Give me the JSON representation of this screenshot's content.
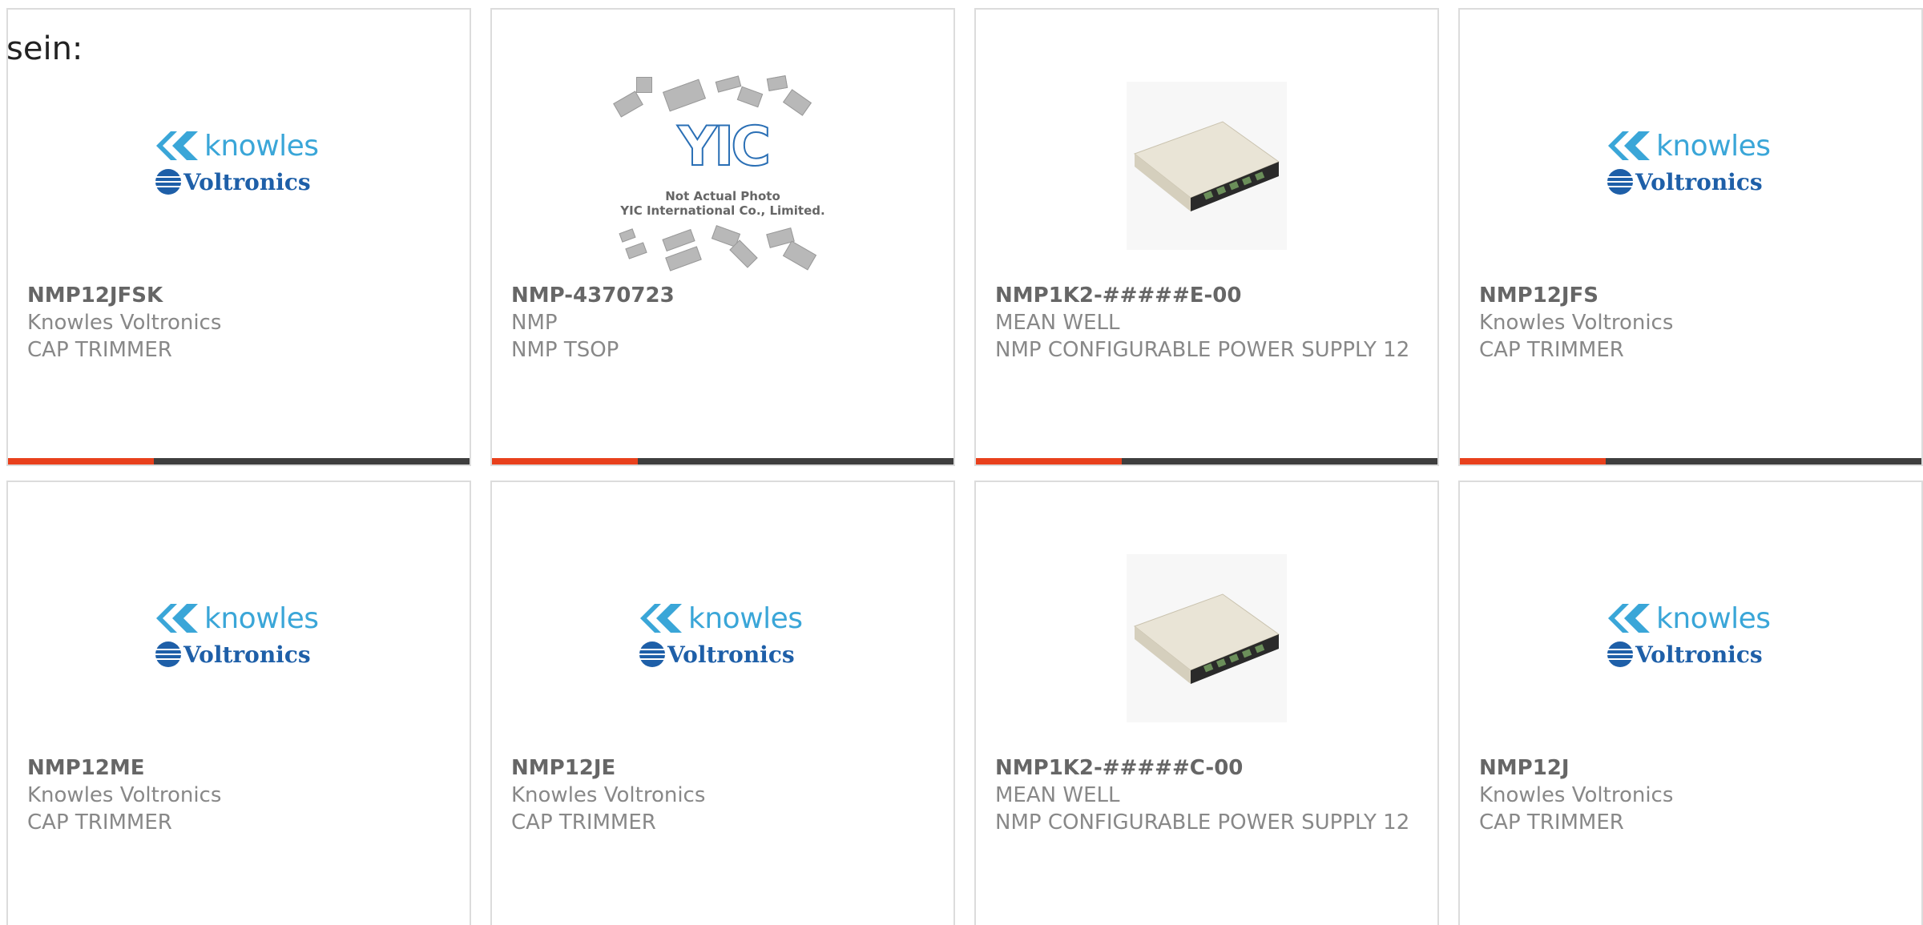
{
  "intro_text": "sein:",
  "cards": [
    {
      "part_number": "NMP12JFSK",
      "manufacturer": "Knowles Voltronics",
      "description": "CAP TRIMMER",
      "image": "knowles-voltronics-logo"
    },
    {
      "part_number": "NMP-4370723",
      "manufacturer": "NMP",
      "description": "NMP TSOP",
      "image": "yic-not-actual-photo"
    },
    {
      "part_number": "NMP1K2-#####E-00",
      "manufacturer": "MEAN WELL",
      "description": "NMP CONFIGURABLE POWER SUPPLY 12",
      "image": "power-supply-photo"
    },
    {
      "part_number": "NMP12JFS",
      "manufacturer": "Knowles Voltronics",
      "description": "CAP TRIMMER",
      "image": "knowles-voltronics-logo"
    },
    {
      "part_number": "NMP12ME",
      "manufacturer": "Knowles Voltronics",
      "description": "CAP TRIMMER",
      "image": "knowles-voltronics-logo"
    },
    {
      "part_number": "NMP12JE",
      "manufacturer": "Knowles Voltronics",
      "description": "CAP TRIMMER",
      "image": "knowles-voltronics-logo"
    },
    {
      "part_number": "NMP1K2-#####C-00",
      "manufacturer": "MEAN WELL",
      "description": "NMP CONFIGURABLE POWER SUPPLY 12",
      "image": "power-supply-photo"
    },
    {
      "part_number": "NMP12J",
      "manufacturer": "Knowles Voltronics",
      "description": "CAP TRIMMER",
      "image": "knowles-voltronics-logo"
    }
  ],
  "logos": {
    "knowles_word": "knowles",
    "voltronics_word": "Voltronics",
    "yic_mark": "YIC",
    "yic_caption_line1": "Not Actual Photo",
    "yic_caption_line2": "YIC International Co., Limited."
  },
  "colors": {
    "accent": "#e8401c",
    "bar_dark": "#3e3e3e",
    "knowles_blue": "#3aa6d8",
    "voltronics_blue": "#1e5fa8"
  }
}
